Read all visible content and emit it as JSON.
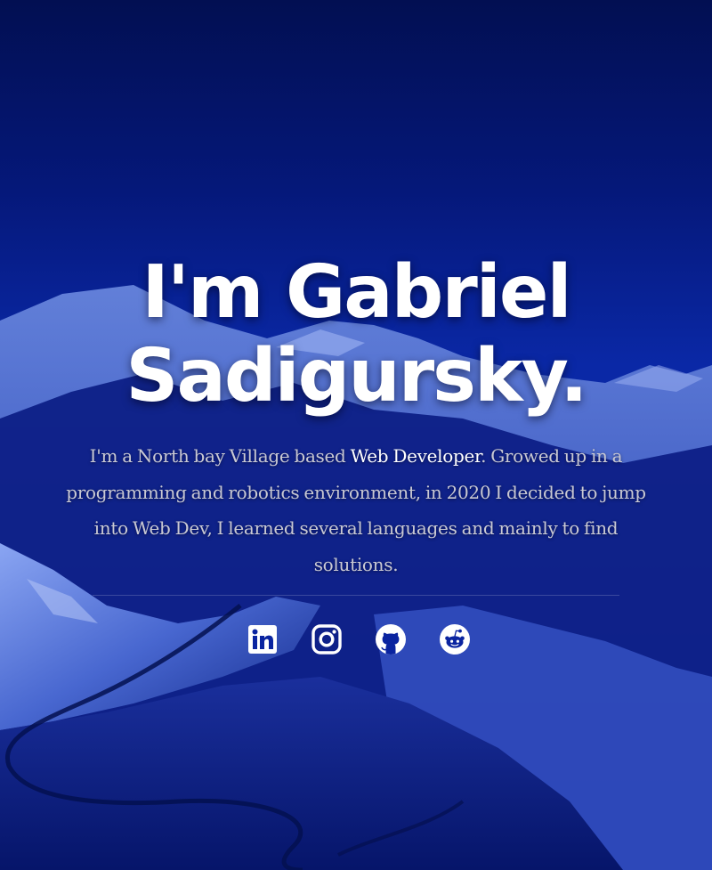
{
  "hero": {
    "headline_line1": "I'm Gabriel",
    "headline_line2": "Sadigursky.",
    "intro_before": "I'm a North bay Village based ",
    "intro_highlight": "Web Developer",
    "intro_after": ". Growed up in a programming and robotics environment, in 2020 I decided to jump into Web Dev, I learned several languages and mainly to find solutions."
  },
  "social": [
    {
      "icon": "linkedin-icon"
    },
    {
      "icon": "instagram-icon"
    },
    {
      "icon": "github-icon"
    },
    {
      "icon": "reddit-icon"
    }
  ],
  "colors": {
    "sky_top": "#021056",
    "sky_bottom": "#0b2aa8",
    "text": "#ffffff",
    "intro_text": "#c9c9d3"
  }
}
